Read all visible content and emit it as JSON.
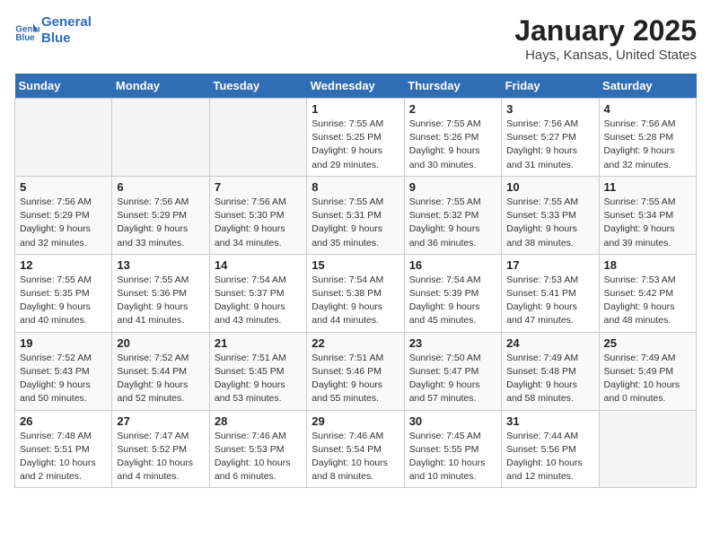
{
  "header": {
    "logo_line1": "General",
    "logo_line2": "Blue",
    "main_title": "January 2025",
    "subtitle": "Hays, Kansas, United States"
  },
  "weekdays": [
    "Sunday",
    "Monday",
    "Tuesday",
    "Wednesday",
    "Thursday",
    "Friday",
    "Saturday"
  ],
  "weeks": [
    [
      {
        "day": "",
        "info": ""
      },
      {
        "day": "",
        "info": ""
      },
      {
        "day": "",
        "info": ""
      },
      {
        "day": "1",
        "info": "Sunrise: 7:55 AM\nSunset: 5:25 PM\nDaylight: 9 hours\nand 29 minutes."
      },
      {
        "day": "2",
        "info": "Sunrise: 7:55 AM\nSunset: 5:26 PM\nDaylight: 9 hours\nand 30 minutes."
      },
      {
        "day": "3",
        "info": "Sunrise: 7:56 AM\nSunset: 5:27 PM\nDaylight: 9 hours\nand 31 minutes."
      },
      {
        "day": "4",
        "info": "Sunrise: 7:56 AM\nSunset: 5:28 PM\nDaylight: 9 hours\nand 32 minutes."
      }
    ],
    [
      {
        "day": "5",
        "info": "Sunrise: 7:56 AM\nSunset: 5:29 PM\nDaylight: 9 hours\nand 32 minutes."
      },
      {
        "day": "6",
        "info": "Sunrise: 7:56 AM\nSunset: 5:29 PM\nDaylight: 9 hours\nand 33 minutes."
      },
      {
        "day": "7",
        "info": "Sunrise: 7:56 AM\nSunset: 5:30 PM\nDaylight: 9 hours\nand 34 minutes."
      },
      {
        "day": "8",
        "info": "Sunrise: 7:55 AM\nSunset: 5:31 PM\nDaylight: 9 hours\nand 35 minutes."
      },
      {
        "day": "9",
        "info": "Sunrise: 7:55 AM\nSunset: 5:32 PM\nDaylight: 9 hours\nand 36 minutes."
      },
      {
        "day": "10",
        "info": "Sunrise: 7:55 AM\nSunset: 5:33 PM\nDaylight: 9 hours\nand 38 minutes."
      },
      {
        "day": "11",
        "info": "Sunrise: 7:55 AM\nSunset: 5:34 PM\nDaylight: 9 hours\nand 39 minutes."
      }
    ],
    [
      {
        "day": "12",
        "info": "Sunrise: 7:55 AM\nSunset: 5:35 PM\nDaylight: 9 hours\nand 40 minutes."
      },
      {
        "day": "13",
        "info": "Sunrise: 7:55 AM\nSunset: 5:36 PM\nDaylight: 9 hours\nand 41 minutes."
      },
      {
        "day": "14",
        "info": "Sunrise: 7:54 AM\nSunset: 5:37 PM\nDaylight: 9 hours\nand 43 minutes."
      },
      {
        "day": "15",
        "info": "Sunrise: 7:54 AM\nSunset: 5:38 PM\nDaylight: 9 hours\nand 44 minutes."
      },
      {
        "day": "16",
        "info": "Sunrise: 7:54 AM\nSunset: 5:39 PM\nDaylight: 9 hours\nand 45 minutes."
      },
      {
        "day": "17",
        "info": "Sunrise: 7:53 AM\nSunset: 5:41 PM\nDaylight: 9 hours\nand 47 minutes."
      },
      {
        "day": "18",
        "info": "Sunrise: 7:53 AM\nSunset: 5:42 PM\nDaylight: 9 hours\nand 48 minutes."
      }
    ],
    [
      {
        "day": "19",
        "info": "Sunrise: 7:52 AM\nSunset: 5:43 PM\nDaylight: 9 hours\nand 50 minutes."
      },
      {
        "day": "20",
        "info": "Sunrise: 7:52 AM\nSunset: 5:44 PM\nDaylight: 9 hours\nand 52 minutes."
      },
      {
        "day": "21",
        "info": "Sunrise: 7:51 AM\nSunset: 5:45 PM\nDaylight: 9 hours\nand 53 minutes."
      },
      {
        "day": "22",
        "info": "Sunrise: 7:51 AM\nSunset: 5:46 PM\nDaylight: 9 hours\nand 55 minutes."
      },
      {
        "day": "23",
        "info": "Sunrise: 7:50 AM\nSunset: 5:47 PM\nDaylight: 9 hours\nand 57 minutes."
      },
      {
        "day": "24",
        "info": "Sunrise: 7:49 AM\nSunset: 5:48 PM\nDaylight: 9 hours\nand 58 minutes."
      },
      {
        "day": "25",
        "info": "Sunrise: 7:49 AM\nSunset: 5:49 PM\nDaylight: 10 hours\nand 0 minutes."
      }
    ],
    [
      {
        "day": "26",
        "info": "Sunrise: 7:48 AM\nSunset: 5:51 PM\nDaylight: 10 hours\nand 2 minutes."
      },
      {
        "day": "27",
        "info": "Sunrise: 7:47 AM\nSunset: 5:52 PM\nDaylight: 10 hours\nand 4 minutes."
      },
      {
        "day": "28",
        "info": "Sunrise: 7:46 AM\nSunset: 5:53 PM\nDaylight: 10 hours\nand 6 minutes."
      },
      {
        "day": "29",
        "info": "Sunrise: 7:46 AM\nSunset: 5:54 PM\nDaylight: 10 hours\nand 8 minutes."
      },
      {
        "day": "30",
        "info": "Sunrise: 7:45 AM\nSunset: 5:55 PM\nDaylight: 10 hours\nand 10 minutes."
      },
      {
        "day": "31",
        "info": "Sunrise: 7:44 AM\nSunset: 5:56 PM\nDaylight: 10 hours\nand 12 minutes."
      },
      {
        "day": "",
        "info": ""
      }
    ]
  ]
}
